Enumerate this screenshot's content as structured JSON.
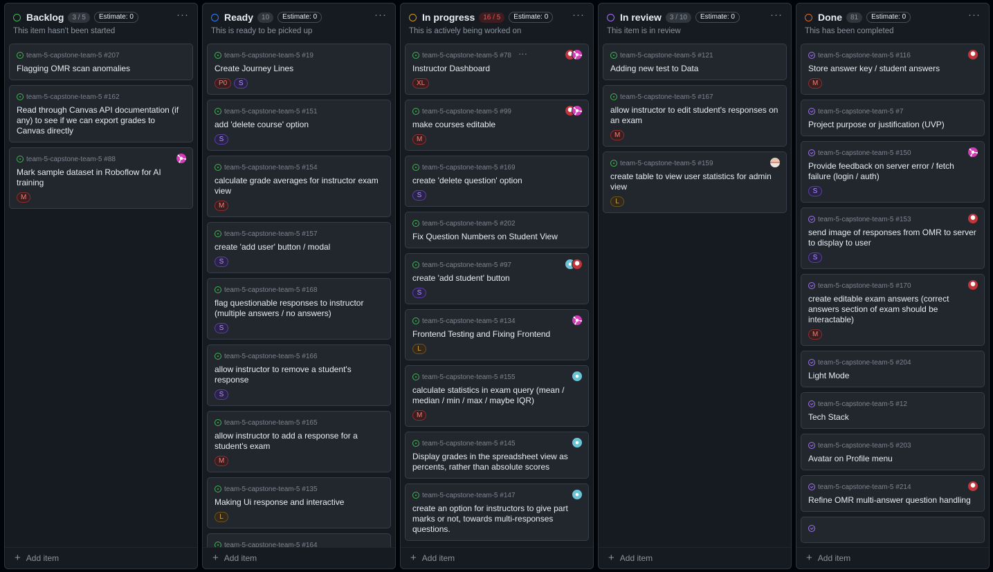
{
  "columns": [
    {
      "name": "Backlog",
      "count": "3 / 5",
      "over": false,
      "estimate": "Estimate: 0",
      "description": "This item hasn't been started",
      "color": "#3fb950",
      "cards": [
        {
          "repo": "team-5-capstone-team-5 #207",
          "title": "Flagging OMR scan anomalies",
          "labels": [],
          "avatars": []
        },
        {
          "repo": "team-5-capstone-team-5 #162",
          "title": "Read through Canvas API documentation (if any) to see if we can export grades to Canvas directly",
          "labels": [],
          "avatars": []
        },
        {
          "repo": "team-5-capstone-team-5 #88",
          "title": "Mark sample dataset in Roboflow for AI training",
          "labels": [
            "M"
          ],
          "avatars": [
            "pink"
          ]
        }
      ]
    },
    {
      "name": "Ready",
      "count": "10",
      "over": false,
      "estimate": "Estimate: 0",
      "description": "This is ready to be picked up",
      "color": "#2f81f7",
      "cards": [
        {
          "repo": "team-5-capstone-team-5 #19",
          "title": "Create Journey Lines",
          "labels": [
            "P0",
            "S"
          ],
          "avatars": []
        },
        {
          "repo": "team-5-capstone-team-5 #151",
          "title": "add 'delete course' option",
          "labels": [
            "S"
          ],
          "avatars": []
        },
        {
          "repo": "team-5-capstone-team-5 #154",
          "title": "calculate grade averages for instructor exam view",
          "labels": [
            "M"
          ],
          "avatars": []
        },
        {
          "repo": "team-5-capstone-team-5 #157",
          "title": "create 'add user' button / modal",
          "labels": [
            "S"
          ],
          "avatars": []
        },
        {
          "repo": "team-5-capstone-team-5 #168",
          "title": "flag questionable responses to instructor (multiple answers / no answers)",
          "labels": [
            "S"
          ],
          "avatars": []
        },
        {
          "repo": "team-5-capstone-team-5 #166",
          "title": "allow instructor to remove a student's response",
          "labels": [
            "S"
          ],
          "avatars": []
        },
        {
          "repo": "team-5-capstone-team-5 #165",
          "title": "allow instructor to add a response for a student's exam",
          "labels": [
            "M"
          ],
          "avatars": []
        },
        {
          "repo": "team-5-capstone-team-5 #135",
          "title": "Making Ui response and interactive",
          "labels": [
            "L"
          ],
          "avatars": []
        },
        {
          "repo": "team-5-capstone-team-5 #164",
          "title": "",
          "labels": [],
          "avatars": []
        }
      ]
    },
    {
      "name": "In progress",
      "count": "16 / 5",
      "over": true,
      "estimate": "Estimate: 0",
      "description": "This is actively being worked on",
      "color": "#d29922",
      "cards": [
        {
          "repo": "team-5-capstone-team-5 #78",
          "title": "Instructor Dashboard",
          "labels": [
            "XL"
          ],
          "avatars": [
            "red",
            "pink"
          ],
          "menu": true
        },
        {
          "repo": "team-5-capstone-team-5 #99",
          "title": "make courses editable",
          "labels": [
            "M"
          ],
          "avatars": [
            "red",
            "pink"
          ]
        },
        {
          "repo": "team-5-capstone-team-5 #169",
          "title": "create 'delete question' option",
          "labels": [
            "S"
          ],
          "avatars": []
        },
        {
          "repo": "team-5-capstone-team-5 #202",
          "title": "Fix Question Numbers on Student View",
          "labels": [],
          "avatars": []
        },
        {
          "repo": "team-5-capstone-team-5 #97",
          "title": "create 'add student' button",
          "labels": [
            "S"
          ],
          "avatars": [
            "teal",
            "red"
          ]
        },
        {
          "repo": "team-5-capstone-team-5 #134",
          "title": "Frontend Testing and Fixing Frontend",
          "labels": [
            "L"
          ],
          "avatars": [
            "pink"
          ]
        },
        {
          "repo": "team-5-capstone-team-5 #155",
          "title": "calculate statistics in exam query (mean / median / min / max / maybe IQR)",
          "labels": [
            "M"
          ],
          "avatars": [
            "teal"
          ]
        },
        {
          "repo": "team-5-capstone-team-5 #145",
          "title": "Display grades in the spreadsheet view as percents, rather than absolute scores",
          "labels": [],
          "avatars": [
            "teal"
          ]
        },
        {
          "repo": "team-5-capstone-team-5 #147",
          "title": "create an option for instructors to give part marks or not, towards multi-responses questions.",
          "labels": [],
          "avatars": [
            "teal"
          ]
        }
      ]
    },
    {
      "name": "In review",
      "count": "3 / 10",
      "over": false,
      "estimate": "Estimate: 0",
      "description": "This item is in review",
      "color": "#a371f7",
      "cards": [
        {
          "repo": "team-5-capstone-team-5 #121",
          "title": "Adding new test to Data",
          "labels": [],
          "avatars": []
        },
        {
          "repo": "team-5-capstone-team-5 #167",
          "title": "allow instructor to edit student's responses on an exam",
          "labels": [
            "M"
          ],
          "avatars": []
        },
        {
          "repo": "team-5-capstone-team-5 #159",
          "title": "create table to view user statistics for admin view",
          "labels": [
            "L"
          ],
          "avatars": [
            "beige"
          ]
        }
      ]
    },
    {
      "name": "Done",
      "count": "81",
      "over": false,
      "estimate": "Estimate: 0",
      "description": "This has been completed",
      "color": "#db6d28",
      "cards": [
        {
          "repo": "team-5-capstone-team-5 #116",
          "title": "Store answer key / student answers",
          "labels": [
            "M"
          ],
          "avatars": [
            "red"
          ],
          "done": true
        },
        {
          "repo": "team-5-capstone-team-5 #7",
          "title": "Project purpose or justification (UVP)",
          "labels": [],
          "avatars": [],
          "done": true
        },
        {
          "repo": "team-5-capstone-team-5 #150",
          "title": "Provide feedback on server error / fetch failure (login / auth)",
          "labels": [
            "S"
          ],
          "avatars": [
            "pink"
          ],
          "done": true
        },
        {
          "repo": "team-5-capstone-team-5 #153",
          "title": "send image of responses from OMR to server to display to user",
          "labels": [
            "S"
          ],
          "avatars": [
            "red"
          ],
          "done": true
        },
        {
          "repo": "team-5-capstone-team-5 #170",
          "title": "create editable exam answers (correct answers section of exam should be interactable)",
          "labels": [
            "M"
          ],
          "avatars": [
            "red"
          ],
          "done": true
        },
        {
          "repo": "team-5-capstone-team-5 #204",
          "title": "Light Mode",
          "labels": [],
          "avatars": [],
          "done": true
        },
        {
          "repo": "team-5-capstone-team-5 #12",
          "title": "Tech Stack",
          "labels": [],
          "avatars": [],
          "done": true
        },
        {
          "repo": "team-5-capstone-team-5 #203",
          "title": "Avatar on Profile menu",
          "labels": [],
          "avatars": [],
          "done": true
        },
        {
          "repo": "team-5-capstone-team-5 #214",
          "title": "Refine OMR multi-answer question handling",
          "labels": [],
          "avatars": [
            "red"
          ],
          "done": true
        },
        {
          "repo": "",
          "title": "",
          "labels": [],
          "avatars": [],
          "done": true
        }
      ]
    }
  ],
  "add_item_label": "Add item",
  "menu_glyph": "···"
}
